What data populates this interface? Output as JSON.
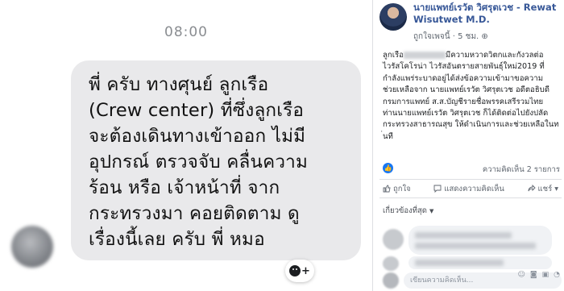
{
  "chat": {
    "timestamp": "08:00",
    "message": "พี่ ครับ ทางศุนย์ ลูกเรือ\n(Crew center) ที่ซึ่งลูกเรือ\nจะต้องเดินทางเข้าออก ไม่มี\nอุปกรณ์ ตรวจจับ คลื่นความ\nร้อน หรือ เจ้าหน้าที่ จาก\nกระทรวงมา คอยติดตาม ดู\nเรื่องนี้เลย ครับ พี่ หมอ",
    "react_plus": "+"
  },
  "post": {
    "author": "นายแพทย์เรวัต วิศรุตเวช - Rewat Wisutwet M.D.",
    "page_label": "ถูกใจเพจนี้",
    "time": "5 ชม.",
    "body_prefix": "ลูกเรือ",
    "body_rest": "มีความหวาดวิตกและกังวลต่อ\nไวรัสโคโรน่า ไวรัสอันตรายสายพันธุ์ใหม่2019 ที่\nกำลังแพร่ระบาดอยู่ได้ส่งข้อความเข้ามาขอความ\nช่วยเหลือจาก นายแพทย์เรวัต วิศรุตเวช อดีตอธิบดี\nกรมการแพทย์ ส.ส.บัญชีรายชื่อพรรคเสรีรวมไทย\nท่านนายแพทย์เรวัต วิศรุตเวช ก็ได้ติดต่อไปยังปลัด\nกระทรวงสาธารณสุข ให้ดำเนินการและช่วยเหลือในท\n่นที",
    "comment_count": "ความคิดเห็น 2 รายการ",
    "actions": {
      "like": "ถูกใจ",
      "comment": "แสดงความคิดเห็น",
      "share": "แชร์"
    },
    "sort_label": "เกี่ยวข้องที่สุด",
    "composer_placeholder": "เขียนความคิดเห็น..."
  },
  "colors": {
    "accent": "#385898",
    "like_blue": "#1877f2",
    "bubble_gray": "#e9e9eb"
  }
}
